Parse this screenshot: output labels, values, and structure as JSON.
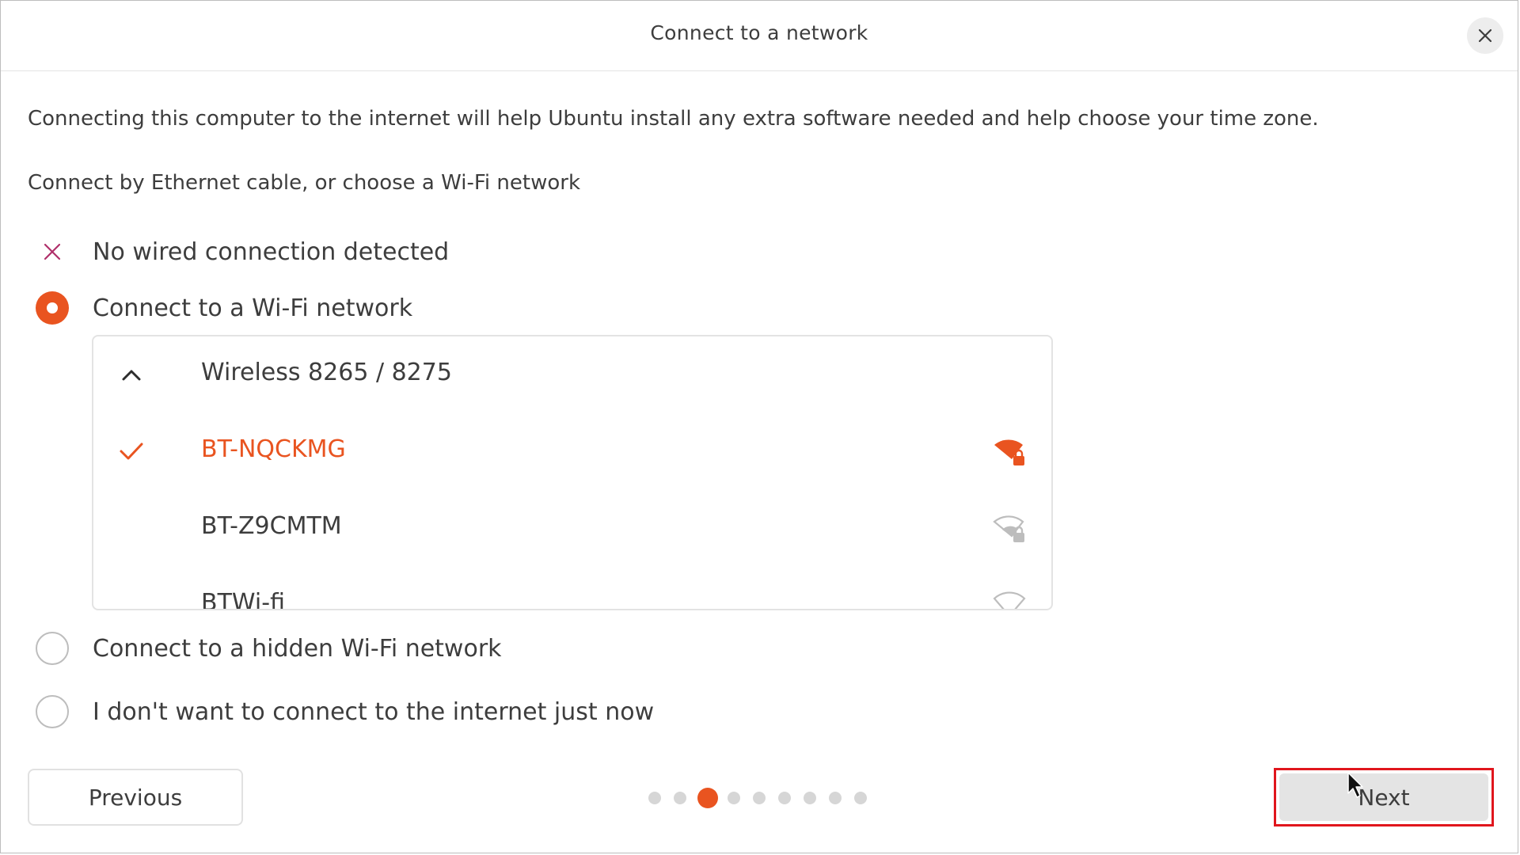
{
  "window": {
    "title": "Connect to a network"
  },
  "content": {
    "intro": "Connecting this computer to the internet will help Ubuntu install any extra software needed and help choose your time zone.",
    "subintro": "Connect by Ethernet cable, or choose a Wi-Fi network",
    "options": {
      "wired": "No wired connection detected",
      "wifi": "Connect to a Wi-Fi network",
      "hidden": "Connect to a hidden Wi-Fi network",
      "none": "I don't want to connect to the internet just now"
    },
    "selected_option": "wifi"
  },
  "wifi_panel": {
    "adapter": "Wireless 8265 / 8275",
    "networks": [
      {
        "name": "BT-NQCKMG",
        "connected": true,
        "secured": true,
        "signal_icon": "wifi-strong-lock-icon"
      },
      {
        "name": "BT-Z9CMTM",
        "connected": false,
        "secured": true,
        "signal_icon": "wifi-weak-lock-icon"
      },
      {
        "name": "BTWi-fi",
        "connected": false,
        "secured": false,
        "signal_icon": "wifi-weak-icon"
      }
    ]
  },
  "footer": {
    "previous": "Previous",
    "next": "Next",
    "pager": {
      "total": 9,
      "current": 3
    }
  },
  "colors": {
    "accent": "#e95420",
    "highlight_box": "#e0161d",
    "error_x": "#b0306a"
  }
}
